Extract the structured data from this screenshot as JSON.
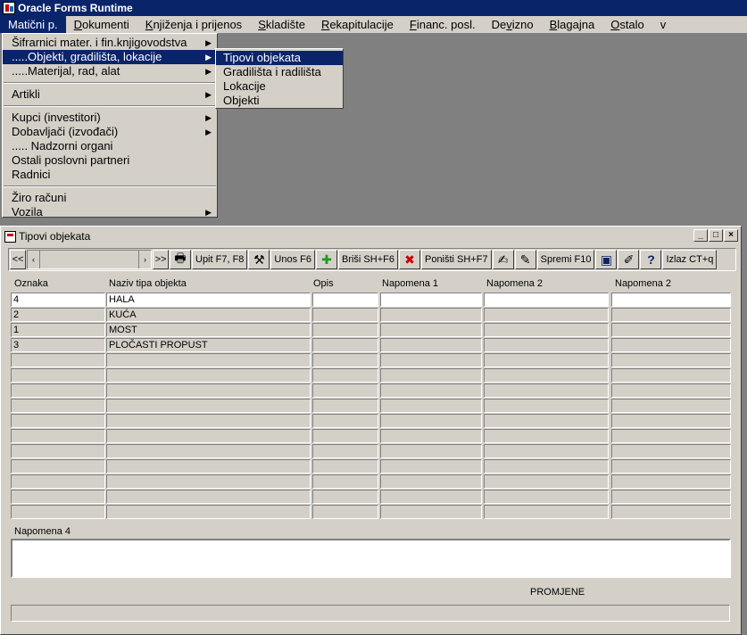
{
  "app": {
    "title": "Oracle Forms Runtime"
  },
  "menubar": {
    "items": [
      {
        "pre": "Matični p.",
        "ul": "",
        "post": ""
      },
      {
        "pre": "",
        "ul": "D",
        "post": "okumenti"
      },
      {
        "pre": "",
        "ul": "K",
        "post": "njiženja i prijenos"
      },
      {
        "pre": "",
        "ul": "S",
        "post": "kladište"
      },
      {
        "pre": "",
        "ul": "R",
        "post": "ekapitulacije"
      },
      {
        "pre": "",
        "ul": "F",
        "post": "inanc. posl."
      },
      {
        "pre": "De",
        "ul": "v",
        "post": "izno"
      },
      {
        "pre": "",
        "ul": "B",
        "post": "lagajna"
      },
      {
        "pre": "",
        "ul": "O",
        "post": "stalo"
      },
      {
        "pre": "",
        "ul": "v",
        "post": ""
      }
    ]
  },
  "menu_maticni": {
    "items": [
      {
        "label": "Šifrarnici mater. i fin.knjigovodstva"
      },
      {
        "label": ".....Objekti, gradilišta, lokacije"
      },
      {
        "label": ".....Materijal, rad, alat"
      },
      {
        "label": "Artikli"
      },
      {
        "label": "Kupci (investitori)"
      },
      {
        "label": "Dobavljači (izvođači)"
      },
      {
        "label": "..... Nadzorni organi"
      },
      {
        "label": "Ostali poslovni partneri"
      },
      {
        "label": "Radnici"
      },
      {
        "label": "Žiro računi"
      },
      {
        "label": "Vozila"
      }
    ]
  },
  "submenu_objekti": {
    "items": [
      {
        "label": "Tipovi objekata"
      },
      {
        "label": "Gradilišta i radilišta"
      },
      {
        "label": "Lokacije"
      },
      {
        "label": "Objekti"
      }
    ]
  },
  "form_window": {
    "title": "Tipovi objekata",
    "controls": {
      "minimize": "_",
      "maximize": "□",
      "close": "×"
    }
  },
  "toolbar": {
    "first": "<<",
    "prev": "‹",
    "next": "›",
    "last": ">>",
    "print_glyph": "🖶",
    "query": "Upit F7, F8",
    "query_glyph": "⚒",
    "insert": "Unos F6",
    "insert_glyph": "✚",
    "delete": "Briši  SH+F6",
    "delete_glyph": "✖",
    "cancel": "Poništi SH+F7",
    "cancel_glyph": "✍",
    "edit_glyph": "✎",
    "save": "Spremi F10",
    "save_glyph": "▣",
    "edit2_glyph": "✐",
    "help_glyph": "?",
    "exit": "Izlaz CT+q"
  },
  "grid": {
    "headers": [
      "Oznaka",
      "Naziv tipa objekta",
      "Opis",
      "Napomena 1",
      "Napomena 2",
      "Napomena 2"
    ],
    "rows": [
      [
        "4",
        "HALA",
        "",
        "",
        "",
        ""
      ],
      [
        "2",
        "KUĆA",
        "",
        "",
        "",
        ""
      ],
      [
        "1",
        "MOST",
        "",
        "",
        "",
        ""
      ],
      [
        "3",
        "PLOČASTI PROPUST",
        "",
        "",
        "",
        ""
      ],
      [
        "",
        "",
        "",
        "",
        "",
        ""
      ],
      [
        "",
        "",
        "",
        "",
        "",
        ""
      ],
      [
        "",
        "",
        "",
        "",
        "",
        ""
      ],
      [
        "",
        "",
        "",
        "",
        "",
        ""
      ],
      [
        "",
        "",
        "",
        "",
        "",
        ""
      ],
      [
        "",
        "",
        "",
        "",
        "",
        ""
      ],
      [
        "",
        "",
        "",
        "",
        "",
        ""
      ],
      [
        "",
        "",
        "",
        "",
        "",
        ""
      ],
      [
        "",
        "",
        "",
        "",
        "",
        ""
      ],
      [
        "",
        "",
        "",
        "",
        "",
        ""
      ],
      [
        "",
        "",
        "",
        "",
        "",
        ""
      ]
    ]
  },
  "napomena4": {
    "label": "Napomena 4",
    "value": ""
  },
  "status": {
    "mode": "PROMJENE",
    "message": ""
  },
  "colors": {
    "title_bar": "#0a246a",
    "face": "#d4d0c8",
    "desktop": "#808080"
  }
}
